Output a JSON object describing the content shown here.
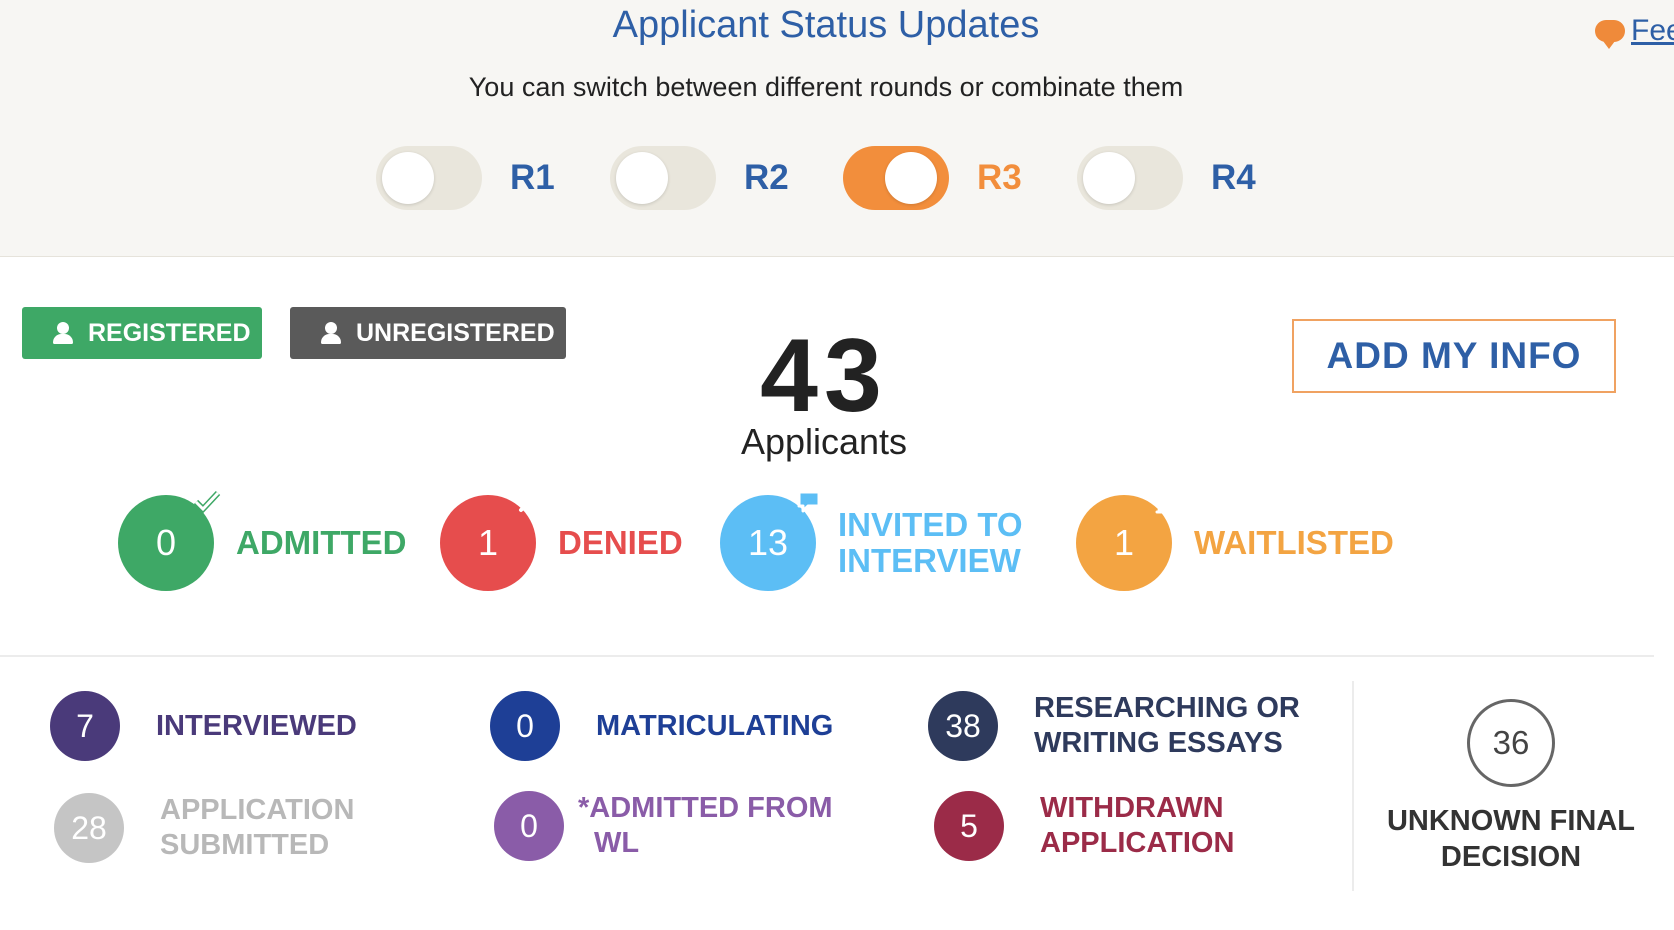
{
  "header": {
    "title": "Applicant Status Updates",
    "subtitle": "You can switch between different rounds or combinate them",
    "feedback_label": "Fee",
    "rounds": [
      {
        "label": "R1",
        "on": false
      },
      {
        "label": "R2",
        "on": false
      },
      {
        "label": "R3",
        "on": true
      },
      {
        "label": "R4",
        "on": false
      }
    ]
  },
  "filters": {
    "registered": "REGISTERED",
    "unregistered": "UNREGISTERED"
  },
  "summary": {
    "total": "43",
    "total_label": "Applicants",
    "add_button": "ADD MY INFO"
  },
  "primary_statuses": [
    {
      "count": "0",
      "line1": "ADMITTED",
      "line2": "",
      "color": "#3ea866",
      "badge": "check-icon"
    },
    {
      "count": "1",
      "line1": "DENIED",
      "line2": "",
      "color": "#e64d4d",
      "badge": "x-icon"
    },
    {
      "count": "13",
      "line1": "INVITED TO",
      "line2": "INTERVIEW",
      "color": "#5cbef5",
      "badge": "speech-bubble-icon"
    },
    {
      "count": "1",
      "line1": "WAITLISTED",
      "line2": "",
      "color": "#f3a442",
      "badge": "hourglass-icon"
    }
  ],
  "secondary_statuses": [
    {
      "count": "7",
      "line1": "INTERVIEWED",
      "line2": "",
      "color": "#4a3a7a"
    },
    {
      "count": "28",
      "line1": "APPLICATION",
      "line2": "SUBMITTED",
      "color": "#c5c5c5"
    },
    {
      "count": "0",
      "line1": "MATRICULATING",
      "line2": "",
      "color": "#1e3f96"
    },
    {
      "count": "0",
      "line1": "*ADMITTED FROM",
      "line2": "WL",
      "color": "#8a5ca8"
    },
    {
      "count": "38",
      "line1": "RESEARCHING OR",
      "line2": "WRITING ESSAYS",
      "color": "#2e3a5c"
    },
    {
      "count": "5",
      "line1": "WITHDRAWN",
      "line2": "APPLICATION",
      "color": "#9b2b48"
    }
  ],
  "final": {
    "count": "36",
    "line1": "UNKNOWN FINAL",
    "line2": "DECISION"
  }
}
